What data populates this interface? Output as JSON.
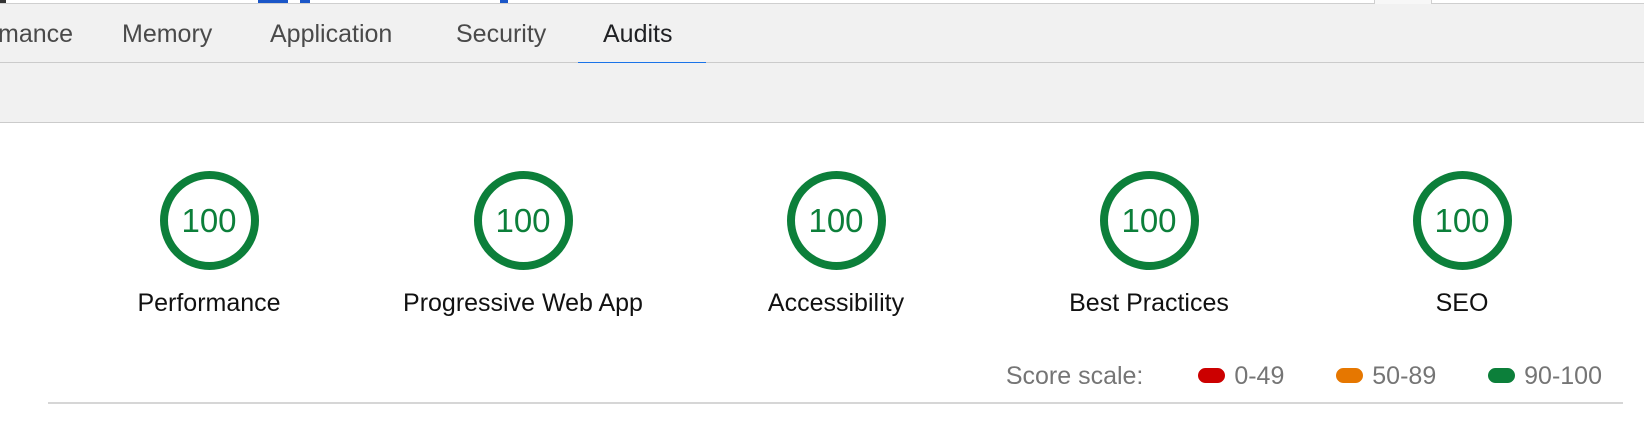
{
  "tabs": [
    {
      "label": "mance"
    },
    {
      "label": "Memory"
    },
    {
      "label": "Application"
    },
    {
      "label": "Security"
    },
    {
      "label": "Audits"
    }
  ],
  "active_tab": "Audits",
  "colors": {
    "pass": "#0c7f3a",
    "average": "#e67700",
    "fail": "#cc0000",
    "tab_accent": "#1a73e8",
    "toolbar_bg": "#f1f1f1"
  },
  "categories": [
    {
      "label": "Performance",
      "score": "100"
    },
    {
      "label": "Progressive Web App",
      "score": "100"
    },
    {
      "label": "Accessibility",
      "score": "100"
    },
    {
      "label": "Best Practices",
      "score": "100"
    },
    {
      "label": "SEO",
      "score": "100"
    }
  ],
  "score_scale": {
    "title": "Score scale:",
    "ranges": [
      {
        "label": "0-49",
        "color": "#cc0000"
      },
      {
        "label": "50-89",
        "color": "#e67700"
      },
      {
        "label": "90-100",
        "color": "#0c7f3a"
      }
    ]
  }
}
